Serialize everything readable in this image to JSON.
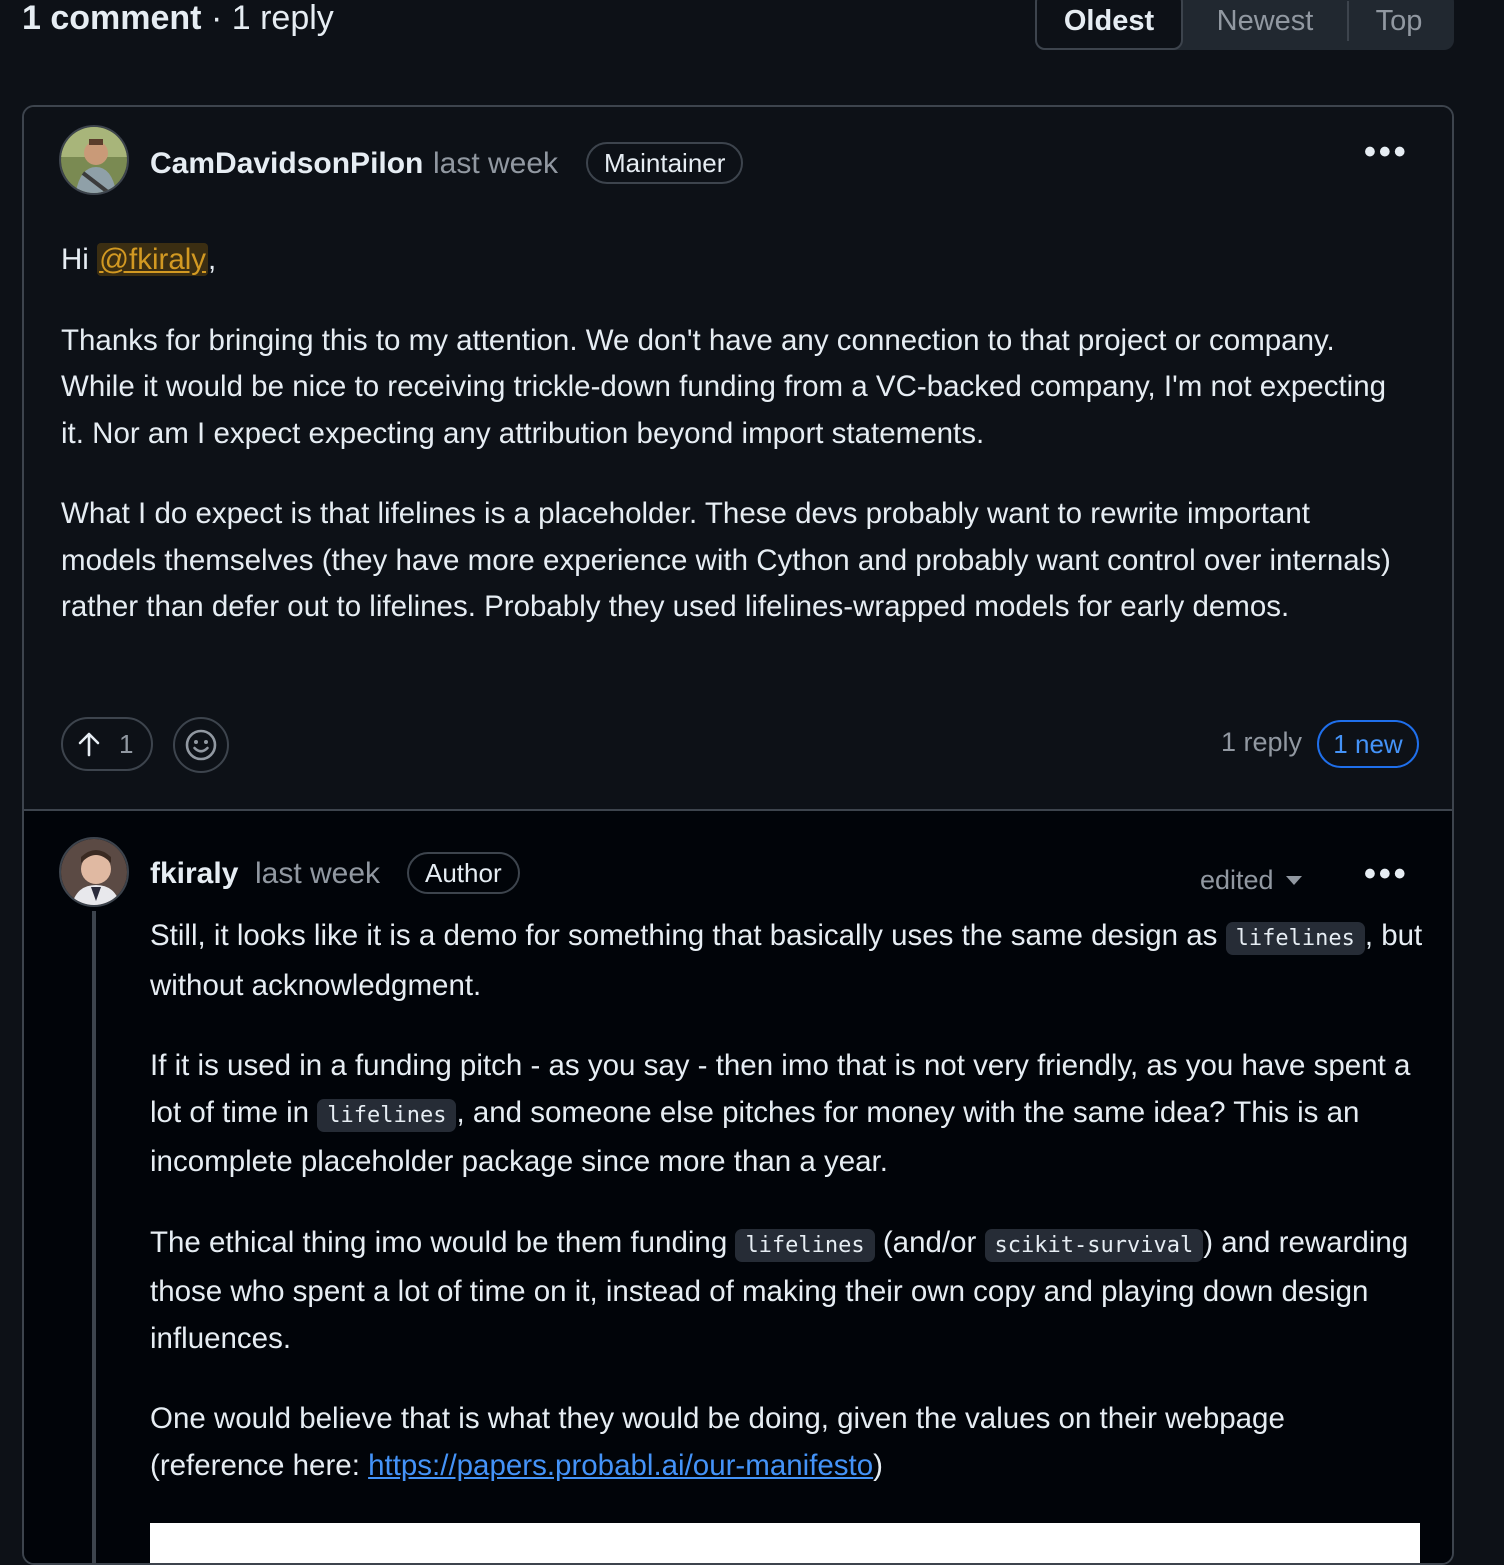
{
  "header": {
    "comment_count": "1 comment",
    "separator": "·",
    "reply_count": "1 reply"
  },
  "sort": {
    "options": [
      "Oldest",
      "Newest",
      "Top"
    ],
    "active": "Oldest"
  },
  "comment": {
    "author": "CamDavidsonPilon",
    "timestamp": "last week",
    "role": "Maintainer",
    "greeting_prefix": "Hi ",
    "mention": "@fkiraly",
    "greeting_suffix": ",",
    "paragraphs": [
      "Thanks for bringing this to my attention. We don't have any connection to that project or company. While it would be nice to receiving trickle-down funding from a VC-backed company, I'm not expecting it. Nor am I expect expecting any attribution beyond import statements.",
      "What I do expect is that lifelines is a placeholder. These devs probably want to rewrite important models themselves (they have more experience with Cython and probably want control over internals) rather than defer out to lifelines. Probably they used lifelines-wrapped models for early demos."
    ],
    "upvotes": "1",
    "replies_label": "1 reply",
    "new_label": "1 new"
  },
  "reply": {
    "author": "fkiraly",
    "timestamp": "last week",
    "role": "Author",
    "edited_label": "edited",
    "p1_a": "Still, it looks like it is a demo for something that basically uses the same design as ",
    "p1_code": "lifelines",
    "p1_b": ", but without acknowledgment.",
    "p2_a": "If it is used in a funding pitch - as you say - then imo that is not very friendly, as you have spent a lot of time in ",
    "p2_code": "lifelines",
    "p2_b": ", and someone else pitches for money with the same idea? This is an incomplete placeholder package since more than a year.",
    "p3_a": "The ethical thing imo would be them funding ",
    "p3_code1": "lifelines",
    "p3_b": " (and/or ",
    "p3_code2": "scikit-survival",
    "p3_c": ") and rewarding those who spent a lot of time on it, instead of making their own copy and playing down design influences.",
    "p4_a": "One would believe that is what they would be doing, given the values on their webpage (reference here: ",
    "p4_link": "https://papers.probabl.ai/our-manifesto",
    "p4_b": ")"
  },
  "colors": {
    "background": "#0d1117",
    "reply_background": "#010409",
    "border": "#3d444d",
    "link": "#4493f8",
    "mention": "#d29922"
  },
  "icons": [
    "arrow-up-icon",
    "smiley-icon",
    "kebab-horizontal-icon",
    "triangle-down-icon"
  ]
}
